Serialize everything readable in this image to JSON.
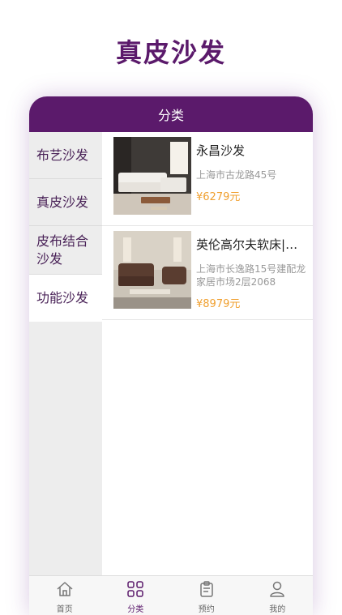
{
  "page": {
    "headline": "真皮沙发"
  },
  "nav": {
    "title": "分类"
  },
  "categories": [
    {
      "label": "布艺沙发",
      "active": false
    },
    {
      "label": "真皮沙发",
      "active": false
    },
    {
      "label": "皮布结合沙发",
      "active": false
    },
    {
      "label": "功能沙发",
      "active": true
    }
  ],
  "products": [
    {
      "name": "永昌沙发",
      "address": "上海市古龙路45号",
      "price": "¥6279元"
    },
    {
      "name": "英伦高尔夫软床|沙…",
      "address": "上海市长逸路15号建配龙家居市场2层2068",
      "price": "¥8979元"
    }
  ],
  "tabs": [
    {
      "label": "首页",
      "icon": "home-icon"
    },
    {
      "label": "分类",
      "icon": "grid-icon"
    },
    {
      "label": "预约",
      "icon": "clipboard-icon"
    },
    {
      "label": "我的",
      "icon": "person-icon"
    }
  ],
  "colors": {
    "brand": "#5b1a6b",
    "price": "#f0a030",
    "sidebar": "#ededed"
  }
}
